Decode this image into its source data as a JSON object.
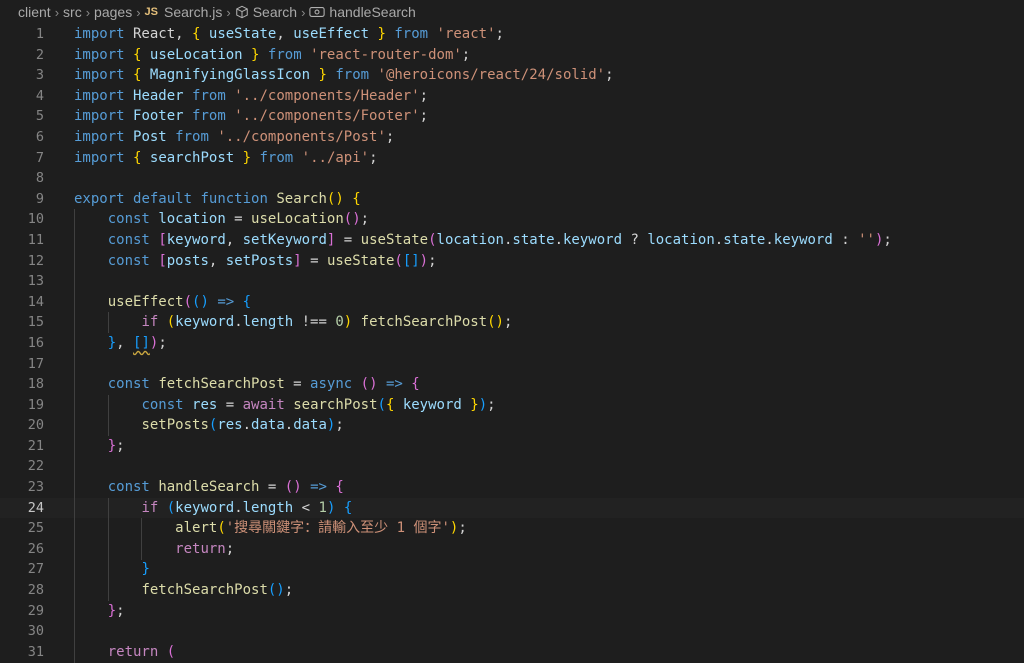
{
  "breadcrumb": {
    "items": [
      "client",
      "src",
      "pages",
      "Search.js",
      "Search",
      "handleSearch"
    ],
    "file_badge": "JS"
  },
  "editor": {
    "active_line": 24,
    "lines": [
      [
        [
          "kw",
          "import"
        ],
        [
          "plain",
          " React, "
        ],
        [
          "b1",
          "{"
        ],
        [
          "plain",
          " "
        ],
        [
          "var",
          "useState"
        ],
        [
          "plain",
          ", "
        ],
        [
          "var",
          "useEffect"
        ],
        [
          "plain",
          " "
        ],
        [
          "b1",
          "}"
        ],
        [
          "plain",
          " "
        ],
        [
          "kw",
          "from"
        ],
        [
          "plain",
          " "
        ],
        [
          "str",
          "'react'"
        ],
        [
          "plain",
          ";"
        ]
      ],
      [
        [
          "kw",
          "import"
        ],
        [
          "plain",
          " "
        ],
        [
          "b1",
          "{"
        ],
        [
          "plain",
          " "
        ],
        [
          "var",
          "useLocation"
        ],
        [
          "plain",
          " "
        ],
        [
          "b1",
          "}"
        ],
        [
          "plain",
          " "
        ],
        [
          "kw",
          "from"
        ],
        [
          "plain",
          " "
        ],
        [
          "str",
          "'react-router-dom'"
        ],
        [
          "plain",
          ";"
        ]
      ],
      [
        [
          "kw",
          "import"
        ],
        [
          "plain",
          " "
        ],
        [
          "b1",
          "{"
        ],
        [
          "plain",
          " "
        ],
        [
          "var",
          "MagnifyingGlassIcon"
        ],
        [
          "plain",
          " "
        ],
        [
          "b1",
          "}"
        ],
        [
          "plain",
          " "
        ],
        [
          "kw",
          "from"
        ],
        [
          "plain",
          " "
        ],
        [
          "str",
          "'@heroicons/react/24/solid'"
        ],
        [
          "plain",
          ";"
        ]
      ],
      [
        [
          "kw",
          "import"
        ],
        [
          "plain",
          " "
        ],
        [
          "var",
          "Header"
        ],
        [
          "plain",
          " "
        ],
        [
          "kw",
          "from"
        ],
        [
          "plain",
          " "
        ],
        [
          "str",
          "'../components/Header'"
        ],
        [
          "plain",
          ";"
        ]
      ],
      [
        [
          "kw",
          "import"
        ],
        [
          "plain",
          " "
        ],
        [
          "var",
          "Footer"
        ],
        [
          "plain",
          " "
        ],
        [
          "kw",
          "from"
        ],
        [
          "plain",
          " "
        ],
        [
          "str",
          "'../components/Footer'"
        ],
        [
          "plain",
          ";"
        ]
      ],
      [
        [
          "kw",
          "import"
        ],
        [
          "plain",
          " "
        ],
        [
          "var",
          "Post"
        ],
        [
          "plain",
          " "
        ],
        [
          "kw",
          "from"
        ],
        [
          "plain",
          " "
        ],
        [
          "str",
          "'../components/Post'"
        ],
        [
          "plain",
          ";"
        ]
      ],
      [
        [
          "kw",
          "import"
        ],
        [
          "plain",
          " "
        ],
        [
          "b1",
          "{"
        ],
        [
          "plain",
          " "
        ],
        [
          "var",
          "searchPost"
        ],
        [
          "plain",
          " "
        ],
        [
          "b1",
          "}"
        ],
        [
          "plain",
          " "
        ],
        [
          "kw",
          "from"
        ],
        [
          "plain",
          " "
        ],
        [
          "str",
          "'../api'"
        ],
        [
          "plain",
          ";"
        ]
      ],
      [],
      [
        [
          "kw",
          "export"
        ],
        [
          "plain",
          " "
        ],
        [
          "kw",
          "default"
        ],
        [
          "plain",
          " "
        ],
        [
          "kw",
          "function"
        ],
        [
          "plain",
          " "
        ],
        [
          "fn",
          "Search"
        ],
        [
          "b1",
          "()"
        ],
        [
          "plain",
          " "
        ],
        [
          "b1",
          "{"
        ]
      ],
      [
        [
          "plain",
          "    "
        ],
        [
          "kw",
          "const"
        ],
        [
          "plain",
          " "
        ],
        [
          "var",
          "location"
        ],
        [
          "plain",
          " = "
        ],
        [
          "fn",
          "useLocation"
        ],
        [
          "b2",
          "()"
        ],
        [
          "plain",
          ";"
        ]
      ],
      [
        [
          "plain",
          "    "
        ],
        [
          "kw",
          "const"
        ],
        [
          "plain",
          " "
        ],
        [
          "b2",
          "["
        ],
        [
          "var",
          "keyword"
        ],
        [
          "plain",
          ", "
        ],
        [
          "var",
          "setKeyword"
        ],
        [
          "b2",
          "]"
        ],
        [
          "plain",
          " = "
        ],
        [
          "fn",
          "useState"
        ],
        [
          "b2",
          "("
        ],
        [
          "var",
          "location"
        ],
        [
          "plain",
          "."
        ],
        [
          "var",
          "state"
        ],
        [
          "plain",
          "."
        ],
        [
          "var",
          "keyword"
        ],
        [
          "plain",
          " ? "
        ],
        [
          "var",
          "location"
        ],
        [
          "plain",
          "."
        ],
        [
          "var",
          "state"
        ],
        [
          "plain",
          "."
        ],
        [
          "var",
          "keyword"
        ],
        [
          "plain",
          " : "
        ],
        [
          "str",
          "''"
        ],
        [
          "b2",
          ")"
        ],
        [
          "plain",
          ";"
        ]
      ],
      [
        [
          "plain",
          "    "
        ],
        [
          "kw",
          "const"
        ],
        [
          "plain",
          " "
        ],
        [
          "b2",
          "["
        ],
        [
          "var",
          "posts"
        ],
        [
          "plain",
          ", "
        ],
        [
          "var",
          "setPosts"
        ],
        [
          "b2",
          "]"
        ],
        [
          "plain",
          " = "
        ],
        [
          "fn",
          "useState"
        ],
        [
          "b2",
          "("
        ],
        [
          "b3",
          "[]"
        ],
        [
          "b2",
          ")"
        ],
        [
          "plain",
          ";"
        ]
      ],
      [],
      [
        [
          "plain",
          "    "
        ],
        [
          "fn",
          "useEffect"
        ],
        [
          "b2",
          "("
        ],
        [
          "b3",
          "()"
        ],
        [
          "plain",
          " "
        ],
        [
          "kw",
          "=>"
        ],
        [
          "plain",
          " "
        ],
        [
          "b3",
          "{"
        ]
      ],
      [
        [
          "plain",
          "        "
        ],
        [
          "ctl",
          "if"
        ],
        [
          "plain",
          " "
        ],
        [
          "b1",
          "("
        ],
        [
          "var",
          "keyword"
        ],
        [
          "plain",
          "."
        ],
        [
          "var",
          "length"
        ],
        [
          "plain",
          " !== "
        ],
        [
          "num",
          "0"
        ],
        [
          "b1",
          ")"
        ],
        [
          "plain",
          " "
        ],
        [
          "fn",
          "fetchSearchPost"
        ],
        [
          "b1",
          "()"
        ],
        [
          "plain",
          ";"
        ]
      ],
      [
        [
          "plain",
          "    "
        ],
        [
          "b3",
          "}"
        ],
        [
          "plain",
          ", "
        ],
        [
          "b3sq",
          "[]"
        ],
        [
          "b2",
          ")"
        ],
        [
          "plain",
          ";"
        ]
      ],
      [],
      [
        [
          "plain",
          "    "
        ],
        [
          "kw",
          "const"
        ],
        [
          "plain",
          " "
        ],
        [
          "fn",
          "fetchSearchPost"
        ],
        [
          "plain",
          " = "
        ],
        [
          "kw",
          "async"
        ],
        [
          "plain",
          " "
        ],
        [
          "b2",
          "()"
        ],
        [
          "plain",
          " "
        ],
        [
          "kw",
          "=>"
        ],
        [
          "plain",
          " "
        ],
        [
          "b2",
          "{"
        ]
      ],
      [
        [
          "plain",
          "        "
        ],
        [
          "kw",
          "const"
        ],
        [
          "plain",
          " "
        ],
        [
          "var",
          "res"
        ],
        [
          "plain",
          " = "
        ],
        [
          "ctl",
          "await"
        ],
        [
          "plain",
          " "
        ],
        [
          "fn",
          "searchPost"
        ],
        [
          "b3",
          "("
        ],
        [
          "b1",
          "{"
        ],
        [
          "plain",
          " "
        ],
        [
          "var",
          "keyword"
        ],
        [
          "plain",
          " "
        ],
        [
          "b1",
          "}"
        ],
        [
          "b3",
          ")"
        ],
        [
          "plain",
          ";"
        ]
      ],
      [
        [
          "plain",
          "        "
        ],
        [
          "fn",
          "setPosts"
        ],
        [
          "b3",
          "("
        ],
        [
          "var",
          "res"
        ],
        [
          "plain",
          "."
        ],
        [
          "var",
          "data"
        ],
        [
          "plain",
          "."
        ],
        [
          "var",
          "data"
        ],
        [
          "b3",
          ")"
        ],
        [
          "plain",
          ";"
        ]
      ],
      [
        [
          "plain",
          "    "
        ],
        [
          "b2",
          "}"
        ],
        [
          "plain",
          ";"
        ]
      ],
      [],
      [
        [
          "plain",
          "    "
        ],
        [
          "kw",
          "const"
        ],
        [
          "plain",
          " "
        ],
        [
          "fn",
          "handleSearch"
        ],
        [
          "plain",
          " = "
        ],
        [
          "b2",
          "()"
        ],
        [
          "plain",
          " "
        ],
        [
          "kw",
          "=>"
        ],
        [
          "plain",
          " "
        ],
        [
          "b2",
          "{"
        ]
      ],
      [
        [
          "plain",
          "        "
        ],
        [
          "ctl",
          "if"
        ],
        [
          "plain",
          " "
        ],
        [
          "b3",
          "("
        ],
        [
          "var",
          "keyword"
        ],
        [
          "plain",
          "."
        ],
        [
          "var",
          "length"
        ],
        [
          "plain",
          " < "
        ],
        [
          "num",
          "1"
        ],
        [
          "b3",
          ")"
        ],
        [
          "plain",
          " "
        ],
        [
          "b3",
          "{"
        ]
      ],
      [
        [
          "plain",
          "            "
        ],
        [
          "fn",
          "alert"
        ],
        [
          "b1",
          "("
        ],
        [
          "str",
          "'搜尋關鍵字：請輸入至少 1 個字'"
        ],
        [
          "b1",
          ")"
        ],
        [
          "plain",
          ";"
        ]
      ],
      [
        [
          "plain",
          "            "
        ],
        [
          "ctl",
          "return"
        ],
        [
          "plain",
          ";"
        ]
      ],
      [
        [
          "plain",
          "        "
        ],
        [
          "b3",
          "}"
        ]
      ],
      [
        [
          "plain",
          "        "
        ],
        [
          "fn",
          "fetchSearchPost"
        ],
        [
          "b3",
          "()"
        ],
        [
          "plain",
          ";"
        ]
      ],
      [
        [
          "plain",
          "    "
        ],
        [
          "b2",
          "}"
        ],
        [
          "plain",
          ";"
        ]
      ],
      [],
      [
        [
          "plain",
          "    "
        ],
        [
          "ctl",
          "return"
        ],
        [
          "plain",
          " "
        ],
        [
          "b2",
          "("
        ]
      ]
    ]
  },
  "colors": {
    "background": "#1e1e1e",
    "keyword": "#569cd6",
    "control": "#c586c0",
    "string": "#ce9178",
    "function": "#dcdcaa",
    "variable": "#9cdcfe",
    "number": "#b5cea8"
  },
  "icons": [
    "chevron-right-icon",
    "js-file-icon",
    "component-cube-icon",
    "function-symbol-icon"
  ]
}
